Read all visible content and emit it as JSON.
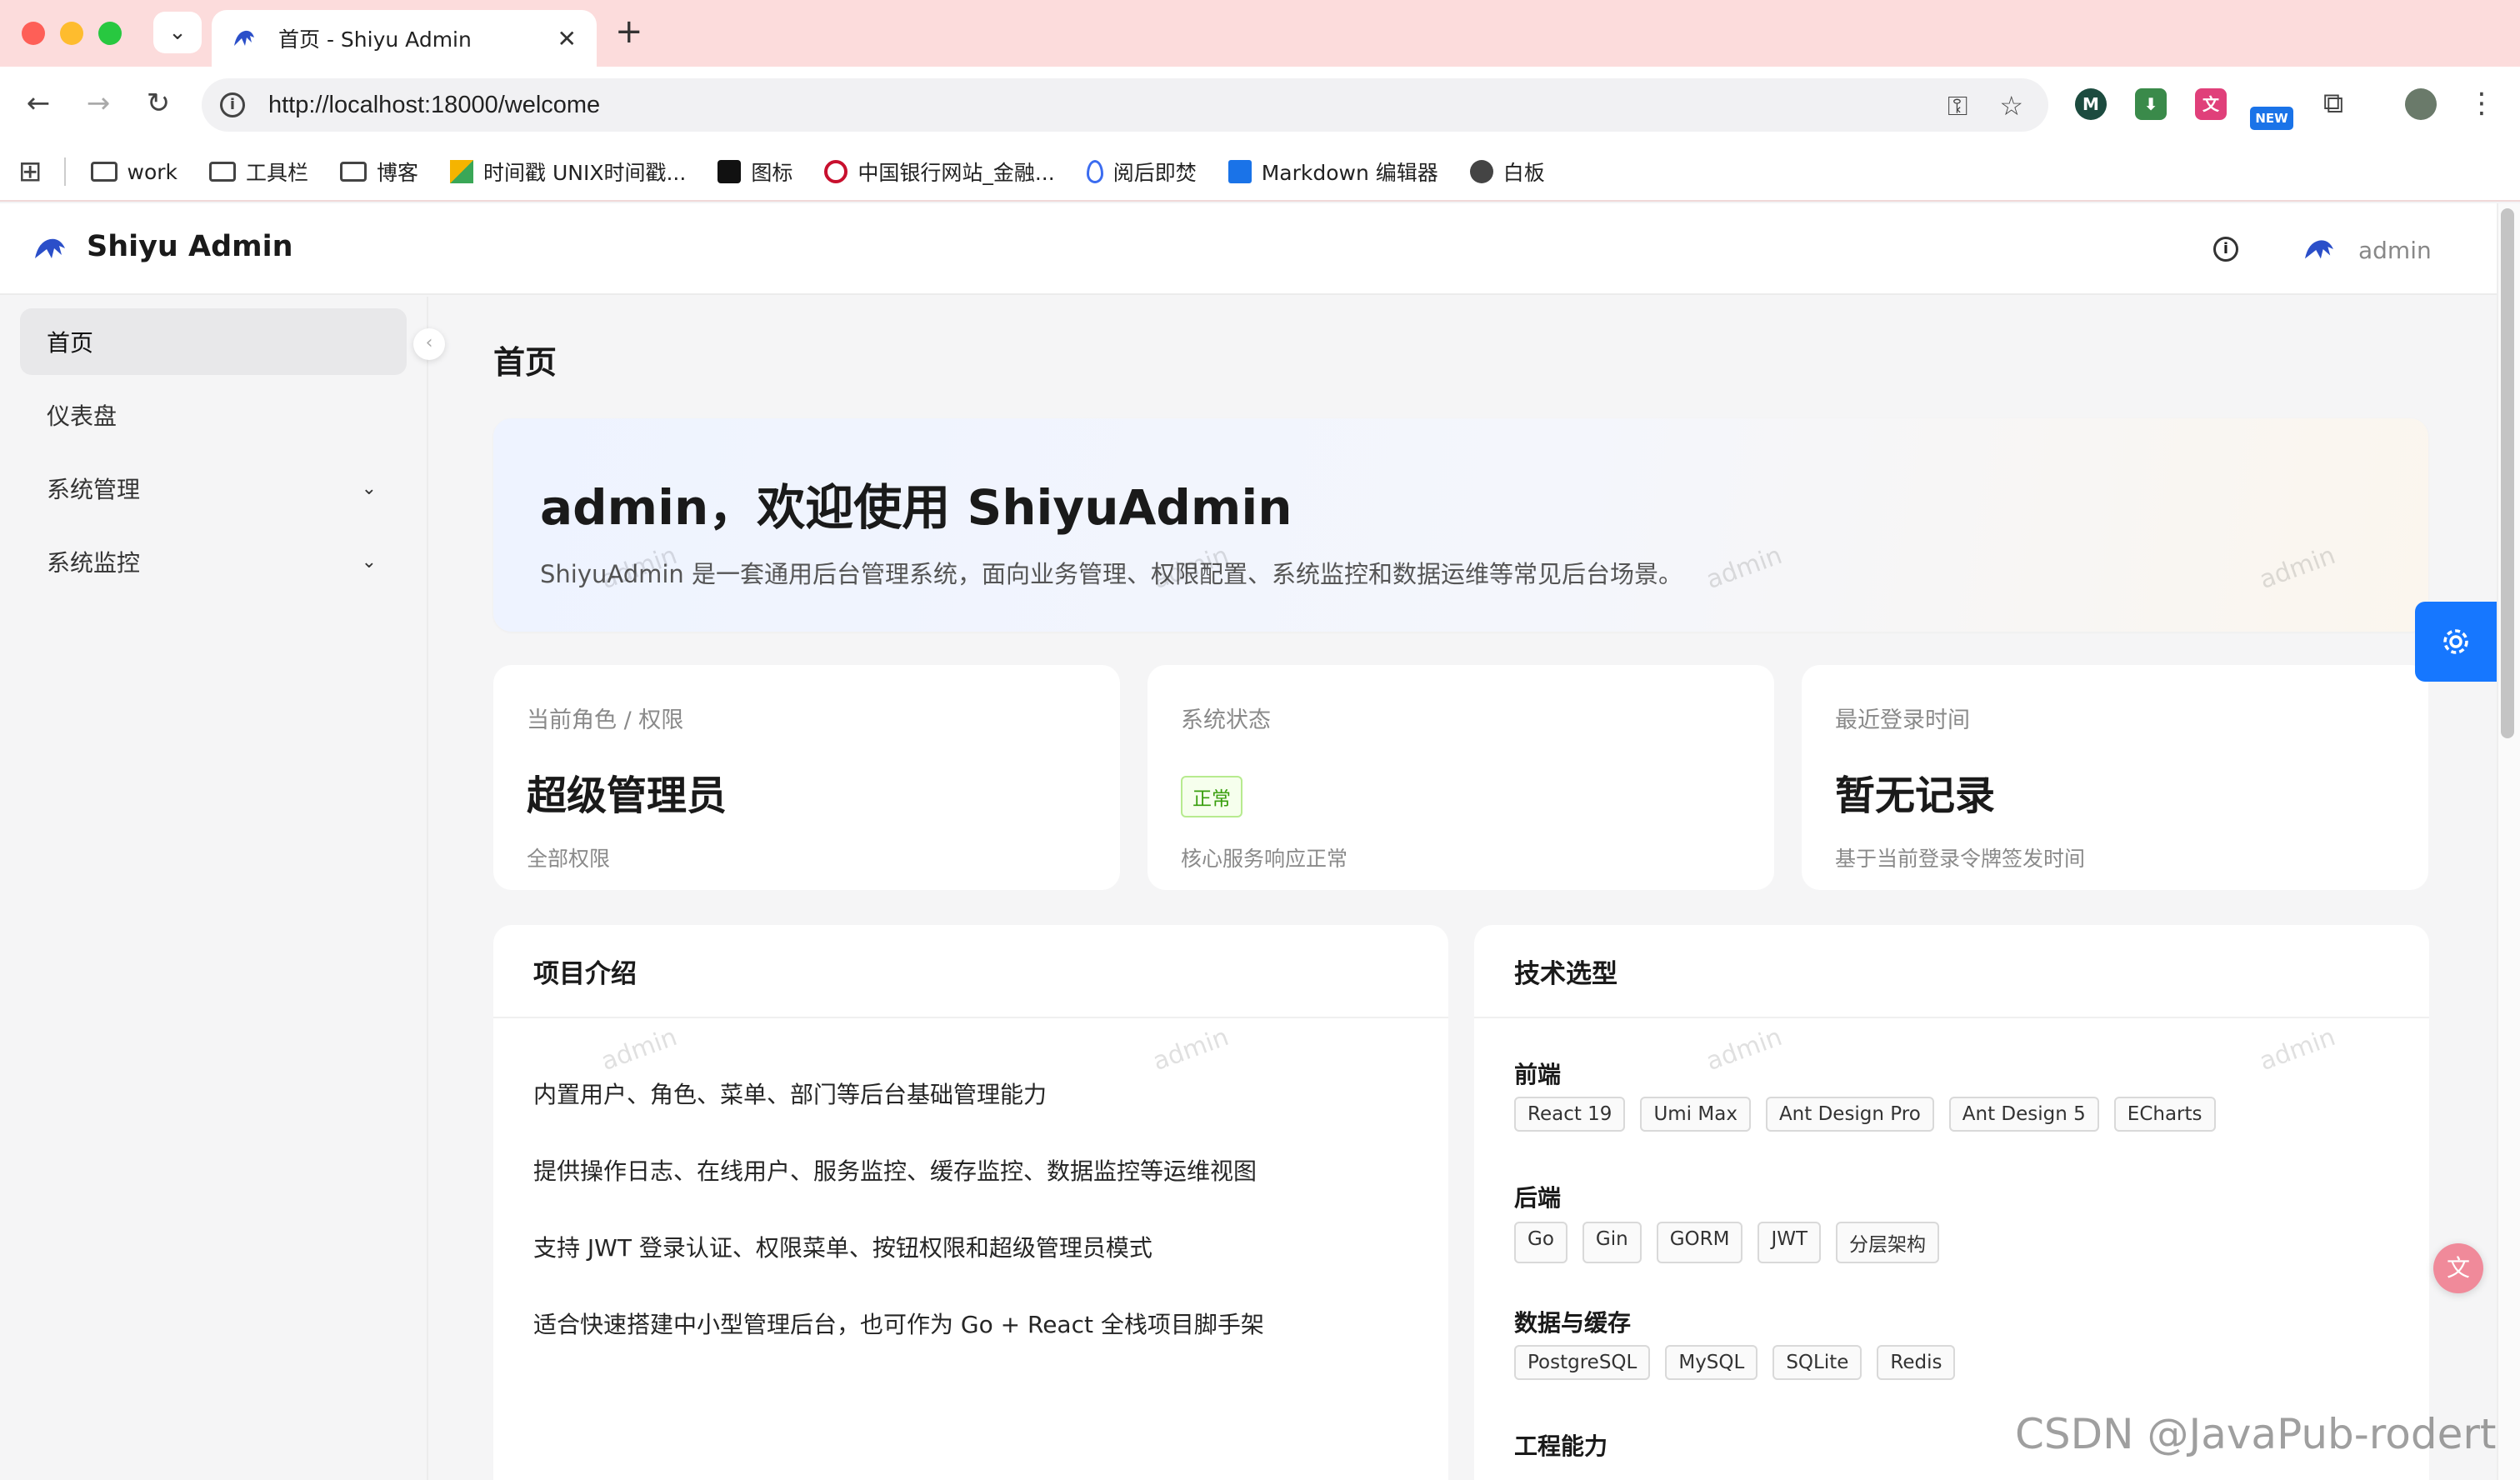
{
  "browser": {
    "tab_title": "首页 - Shiyu Admin",
    "url": "http://localhost:18000/welcome",
    "extensions": [
      "M",
      "⬇",
      "文",
      "NEW"
    ],
    "bookmarks": [
      {
        "label": "work",
        "icon": "folder-icon"
      },
      {
        "label": "工具栏",
        "icon": "folder-icon"
      },
      {
        "label": "博客",
        "icon": "folder-icon"
      },
      {
        "label": "时间戳 UNIX时间戳...",
        "icon": "time-icon"
      },
      {
        "label": "图标",
        "icon": "icon-site"
      },
      {
        "label": "中国银行网站_金融...",
        "icon": "bank-icon"
      },
      {
        "label": "阅后即焚",
        "icon": "fire-icon"
      },
      {
        "label": "Markdown 编辑器",
        "icon": "markdown-icon"
      },
      {
        "label": "白板",
        "icon": "globe-icon"
      }
    ]
  },
  "header": {
    "brand": "Shiyu Admin",
    "user": "admin"
  },
  "sidebar": {
    "items": [
      {
        "label": "首页",
        "active": true
      },
      {
        "label": "仪表盘"
      },
      {
        "label": "系统管理",
        "expandable": true
      },
      {
        "label": "系统监控",
        "expandable": true
      }
    ]
  },
  "page": {
    "title": "首页",
    "welcome_title": "admin，欢迎使用 ShiyuAdmin",
    "welcome_desc": "ShiyuAdmin 是一套通用后台管理系统，面向业务管理、权限配置、系统监控和数据运维等常见后台场景。"
  },
  "stats": [
    {
      "label": "当前角色 / 权限",
      "value": "超级管理员",
      "sub": "全部权限"
    },
    {
      "label": "系统状态",
      "badge": "正常",
      "sub": "核心服务响应正常"
    },
    {
      "label": "最近登录时间",
      "value": "暂无记录",
      "sub": "基于当前登录令牌签发时间"
    }
  ],
  "intro": {
    "title": "项目介绍",
    "lines": [
      "内置用户、角色、菜单、部门等后台基础管理能力",
      "提供操作日志、在线用户、服务监控、缓存监控、数据监控等运维视图",
      "支持 JWT 登录认证、权限菜单、按钮权限和超级管理员模式",
      "适合快速搭建中小型管理后台，也可作为 Go + React 全栈项目脚手架"
    ]
  },
  "tech": {
    "title": "技术选型",
    "groups": [
      {
        "title": "前端",
        "tags": [
          "React 19",
          "Umi Max",
          "Ant Design Pro",
          "Ant Design 5",
          "ECharts"
        ]
      },
      {
        "title": "后端",
        "tags": [
          "Go",
          "Gin",
          "GORM",
          "JWT",
          "分层架构"
        ]
      },
      {
        "title": "数据与缓存",
        "tags": [
          "PostgreSQL",
          "MySQL",
          "SQLite",
          "Redis"
        ]
      },
      {
        "title": "工程能力",
        "tags": []
      }
    ]
  },
  "watermark": "admin",
  "footer_watermark": "CSDN @JavaPub-rodert",
  "colors": {
    "primary": "#1677ff",
    "success": "#389e0d"
  }
}
